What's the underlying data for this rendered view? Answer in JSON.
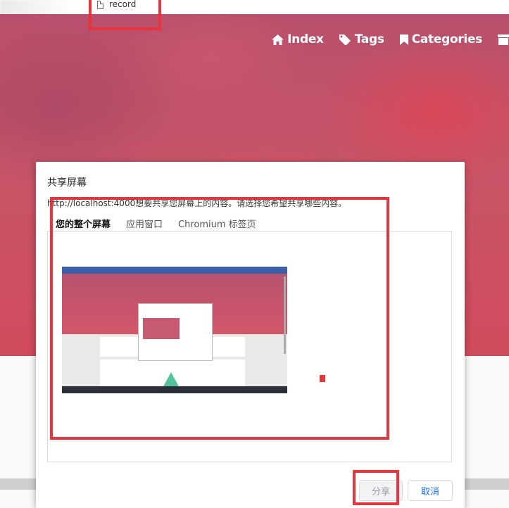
{
  "browser": {
    "tab_title": "record"
  },
  "site": {
    "nav": [
      {
        "label": "Index",
        "icon": "home-icon"
      },
      {
        "label": "Tags",
        "icon": "tag-icon"
      },
      {
        "label": "Categories",
        "icon": "bookmark-icon"
      },
      {
        "label": "",
        "icon": "archive-icon"
      }
    ]
  },
  "dialog": {
    "title": "共享屏幕",
    "description": "http://localhost:4000想要共享您屏幕上的内容。请选择您希望共享哪些内容。",
    "tabs": [
      {
        "label": "您的整个屏幕",
        "active": true
      },
      {
        "label": "应用窗口",
        "active": false
      },
      {
        "label": "Chromium 标签页",
        "active": false
      }
    ],
    "share_label": "分享",
    "cancel_label": "取消"
  },
  "colors": {
    "annotation": "#e8343c",
    "hero_base": "#c85568",
    "cancel_text": "#1a73e8"
  }
}
